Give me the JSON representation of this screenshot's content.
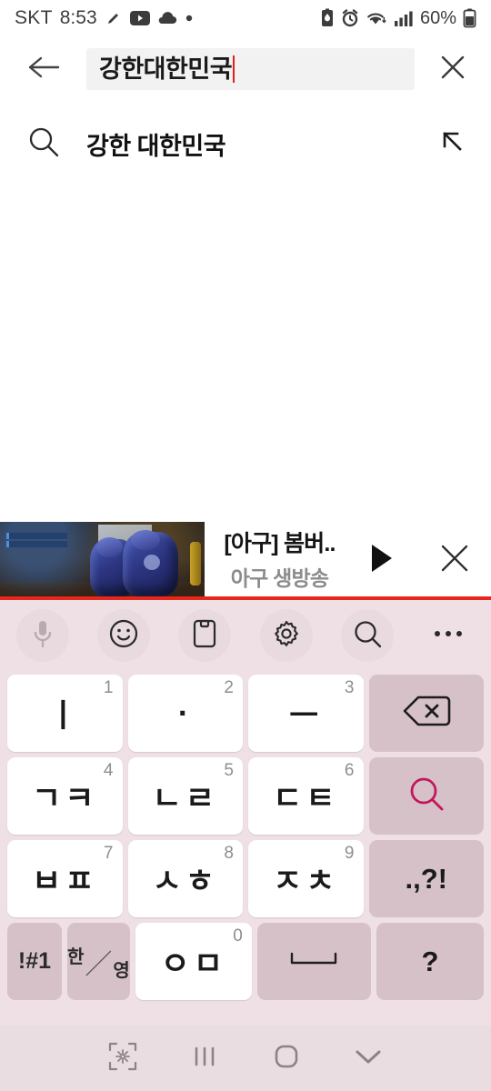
{
  "statusbar": {
    "carrier": "SKT",
    "time": "8:53",
    "battery_percent": "60%",
    "left_icons": [
      "pen-icon",
      "youtube-icon",
      "cloud-icon",
      "dot-icon"
    ],
    "right_icons": [
      "battery-saver-icon",
      "alarm-icon",
      "wifi-icon",
      "signal-icon",
      "battery-icon"
    ]
  },
  "searchbar": {
    "back_icon": "back-arrow-icon",
    "query": "강한대한민국",
    "clear_icon": "close-icon",
    "caret_color": "#e02020"
  },
  "suggestion": {
    "icon": "search-icon",
    "text": "강한 대한민국",
    "insert_icon": "arrow-up-left-icon"
  },
  "mini_player": {
    "title": "[아구] 봄버..",
    "channel": "아구 생방송",
    "play_icon": "play-icon",
    "close_icon": "close-icon",
    "progress_color": "#e8261c"
  },
  "keyboard": {
    "toolbar": [
      {
        "name": "mic-icon",
        "disabled": true
      },
      {
        "name": "emoji-icon",
        "disabled": false
      },
      {
        "name": "clipboard-icon",
        "disabled": false
      },
      {
        "name": "settings-icon",
        "disabled": false
      },
      {
        "name": "search-icon",
        "disabled": false
      },
      {
        "name": "more-icon",
        "disabled": false
      }
    ],
    "rows": [
      [
        {
          "label": "ㅣ",
          "num": "1",
          "type": "char"
        },
        {
          "label": "·",
          "num": "2",
          "type": "char"
        },
        {
          "label": "ㅡ",
          "num": "3",
          "type": "char"
        },
        {
          "label": "",
          "num": "",
          "type": "fn",
          "icon": "backspace-icon"
        }
      ],
      [
        {
          "label": "ㄱㅋ",
          "num": "4",
          "type": "char"
        },
        {
          "label": "ㄴㄹ",
          "num": "5",
          "type": "char"
        },
        {
          "label": "ㄷㅌ",
          "num": "6",
          "type": "char"
        },
        {
          "label": "",
          "num": "",
          "type": "fn",
          "icon": "search-icon"
        }
      ],
      [
        {
          "label": "ㅂㅍ",
          "num": "7",
          "type": "char"
        },
        {
          "label": "ㅅㅎ",
          "num": "8",
          "type": "char"
        },
        {
          "label": "ㅈㅊ",
          "num": "9",
          "type": "char"
        },
        {
          "label": ".,?!",
          "num": "",
          "type": "fn"
        }
      ],
      [
        {
          "label": "!#1",
          "num": "",
          "type": "fn"
        },
        {
          "label": "한/영",
          "num": "",
          "type": "fn",
          "icon": "lang-toggle-icon"
        },
        {
          "label": "ㅇㅁ",
          "num": "0",
          "type": "char"
        },
        {
          "label": "",
          "num": "",
          "type": "fn",
          "icon": "space-icon"
        },
        {
          "label": "?",
          "num": "",
          "type": "fn"
        }
      ]
    ],
    "key_bg": "#ffffff",
    "fn_key_bg": "#d6c1c8",
    "background": "#eee0e4",
    "accent_color": "#c2185b"
  },
  "navbar": {
    "items": [
      "minimize-keyboard-icon",
      "recents-icon",
      "home-icon",
      "hide-keyboard-icon"
    ]
  }
}
